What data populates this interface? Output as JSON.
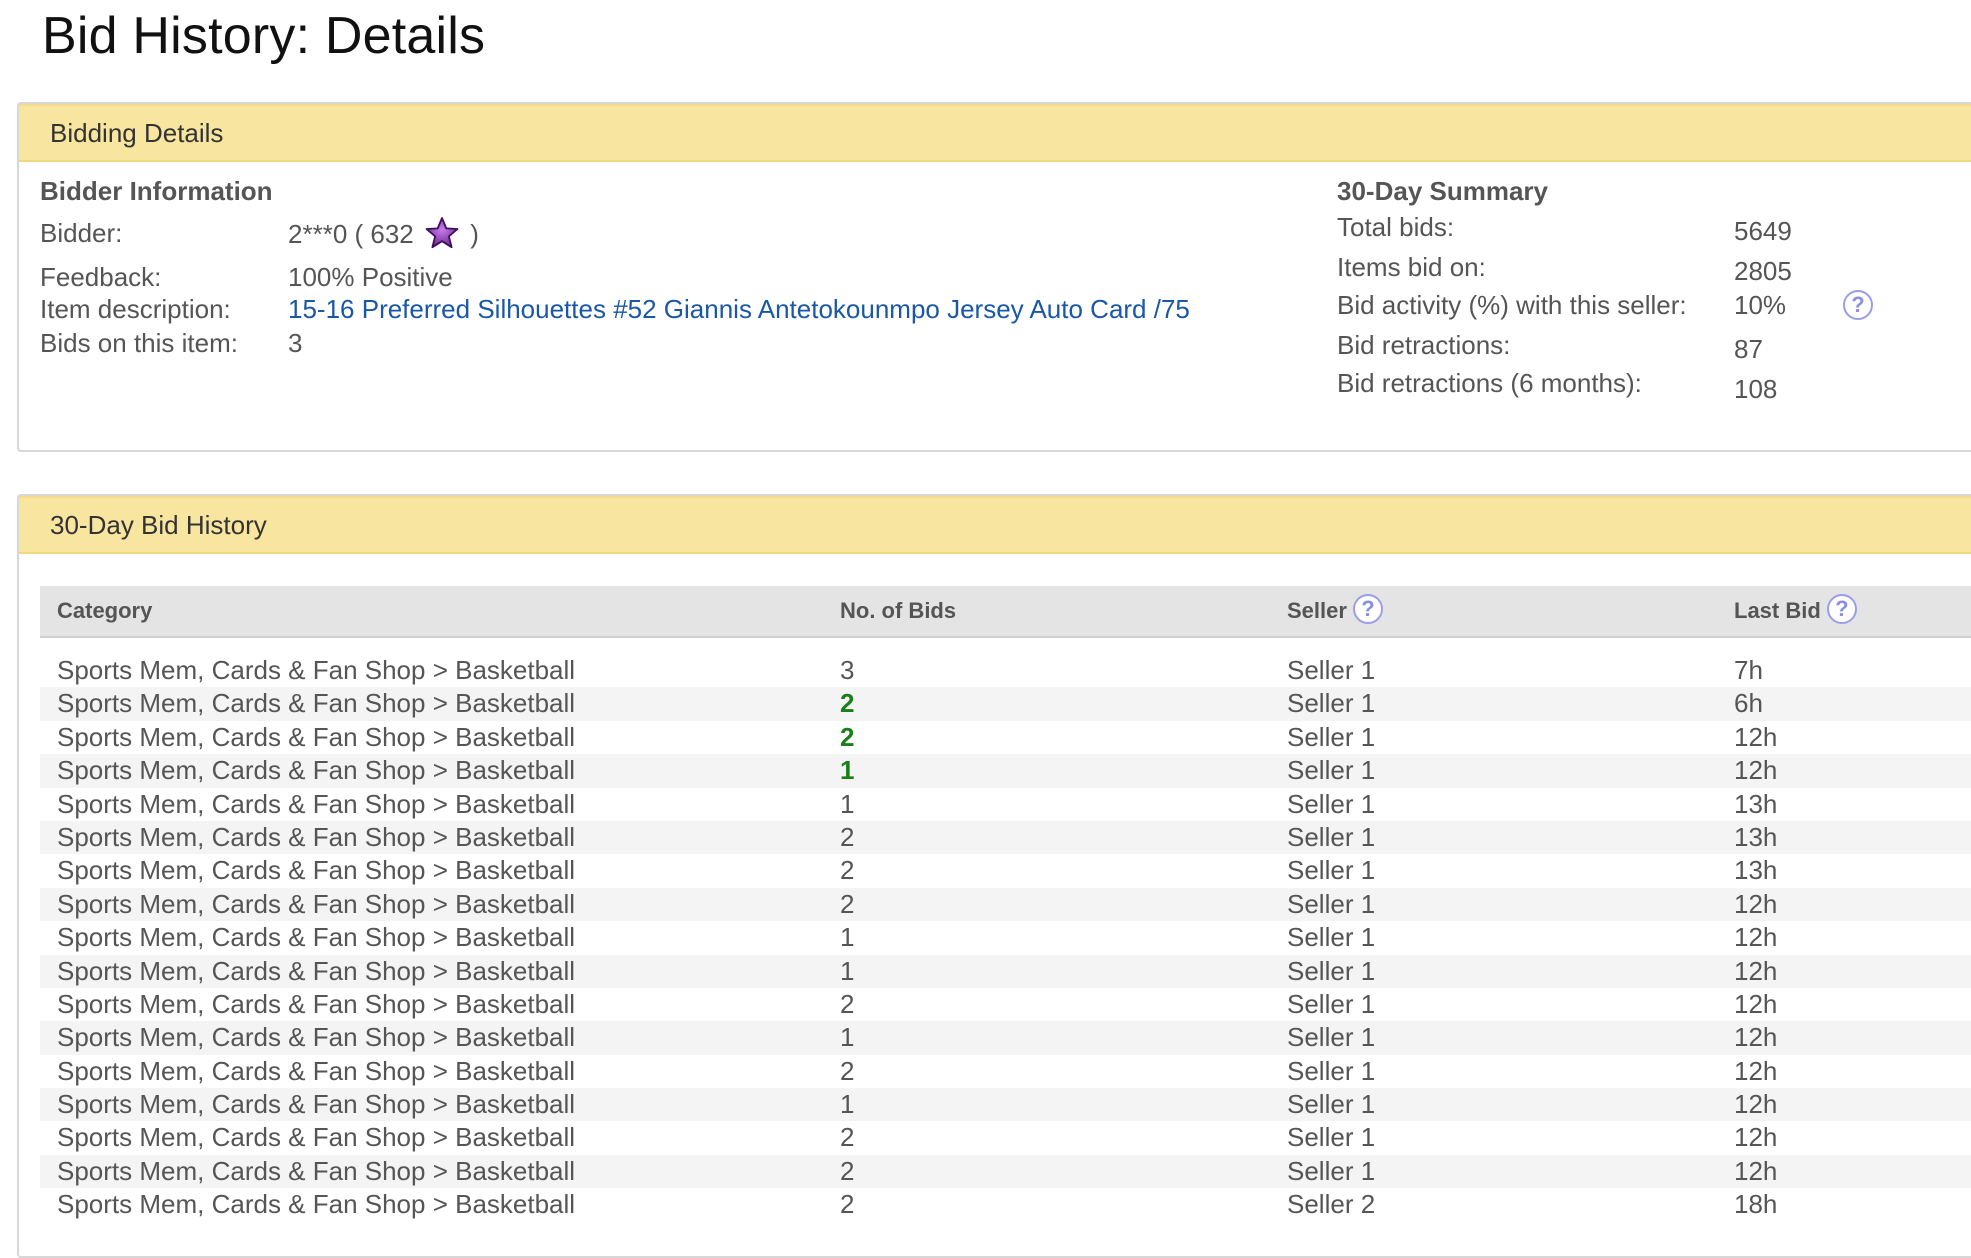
{
  "page_title": "Bid History: Details",
  "bidding_details": {
    "header": "Bidding Details",
    "bidder_info": {
      "heading": "Bidder Information",
      "bidder_label": "Bidder:",
      "bidder_value_prefix": "2***0 ( 632",
      "bidder_value_suffix": ")",
      "feedback_label": "Feedback:",
      "feedback_value": "100% Positive",
      "item_label": "Item description:",
      "item_value": "15-16 Preferred Silhouettes #52 Giannis Antetokounmpo Jersey Auto Card /75",
      "bids_label": "Bids on this item:",
      "bids_value": "3"
    },
    "summary": {
      "heading": "30-Day Summary",
      "total_bids_label": "Total bids:",
      "total_bids_value": "5649",
      "items_bid_label": "Items bid on:",
      "items_bid_value": "2805",
      "activity_label": "Bid activity (%) with this seller:",
      "activity_value": "10%",
      "retractions_label": "Bid retractions:",
      "retractions_value": "87",
      "retractions6_label": "Bid retractions (6 months):",
      "retractions6_value": "108"
    }
  },
  "history": {
    "header": "30-Day Bid History",
    "columns": {
      "category": "Category",
      "bids": "No. of Bids",
      "seller": "Seller",
      "last_bid": "Last Bid"
    },
    "help_glyph": "?",
    "rows": [
      {
        "category": "Sports Mem, Cards & Fan Shop > Basketball",
        "bids": "3",
        "highlight": false,
        "seller": "Seller 1",
        "last": "7h"
      },
      {
        "category": "Sports Mem, Cards & Fan Shop > Basketball",
        "bids": "2",
        "highlight": true,
        "seller": "Seller 1",
        "last": "6h"
      },
      {
        "category": "Sports Mem, Cards & Fan Shop > Basketball",
        "bids": "2",
        "highlight": true,
        "seller": "Seller 1",
        "last": "12h"
      },
      {
        "category": "Sports Mem, Cards & Fan Shop > Basketball",
        "bids": "1",
        "highlight": true,
        "seller": "Seller 1",
        "last": "12h"
      },
      {
        "category": "Sports Mem, Cards & Fan Shop > Basketball",
        "bids": "1",
        "highlight": false,
        "seller": "Seller 1",
        "last": "13h"
      },
      {
        "category": "Sports Mem, Cards & Fan Shop > Basketball",
        "bids": "2",
        "highlight": false,
        "seller": "Seller 1",
        "last": "13h"
      },
      {
        "category": "Sports Mem, Cards & Fan Shop > Basketball",
        "bids": "2",
        "highlight": false,
        "seller": "Seller 1",
        "last": "13h"
      },
      {
        "category": "Sports Mem, Cards & Fan Shop > Basketball",
        "bids": "2",
        "highlight": false,
        "seller": "Seller 1",
        "last": "12h"
      },
      {
        "category": "Sports Mem, Cards & Fan Shop > Basketball",
        "bids": "1",
        "highlight": false,
        "seller": "Seller 1",
        "last": "12h"
      },
      {
        "category": "Sports Mem, Cards & Fan Shop > Basketball",
        "bids": "1",
        "highlight": false,
        "seller": "Seller 1",
        "last": "12h"
      },
      {
        "category": "Sports Mem, Cards & Fan Shop > Basketball",
        "bids": "2",
        "highlight": false,
        "seller": "Seller 1",
        "last": "12h"
      },
      {
        "category": "Sports Mem, Cards & Fan Shop > Basketball",
        "bids": "1",
        "highlight": false,
        "seller": "Seller 1",
        "last": "12h"
      },
      {
        "category": "Sports Mem, Cards & Fan Shop > Basketball",
        "bids": "2",
        "highlight": false,
        "seller": "Seller 1",
        "last": "12h"
      },
      {
        "category": "Sports Mem, Cards & Fan Shop > Basketball",
        "bids": "1",
        "highlight": false,
        "seller": "Seller 1",
        "last": "12h"
      },
      {
        "category": "Sports Mem, Cards & Fan Shop > Basketball",
        "bids": "2",
        "highlight": false,
        "seller": "Seller 1",
        "last": "12h"
      },
      {
        "category": "Sports Mem, Cards & Fan Shop > Basketball",
        "bids": "2",
        "highlight": false,
        "seller": "Seller 1",
        "last": "12h"
      },
      {
        "category": "Sports Mem, Cards & Fan Shop > Basketball",
        "bids": "2",
        "highlight": false,
        "seller": "Seller 2",
        "last": "18h"
      }
    ]
  },
  "colors": {
    "panel_header_bg": "#f8e6a0",
    "link": "#1a57a6",
    "highlight_bids": "#1a7f1a",
    "help_icon": "#8a8fe2",
    "star": "#8e3fb5"
  },
  "icons": {
    "feedback_star": "purple-star-icon",
    "help": "question-circle-icon"
  }
}
